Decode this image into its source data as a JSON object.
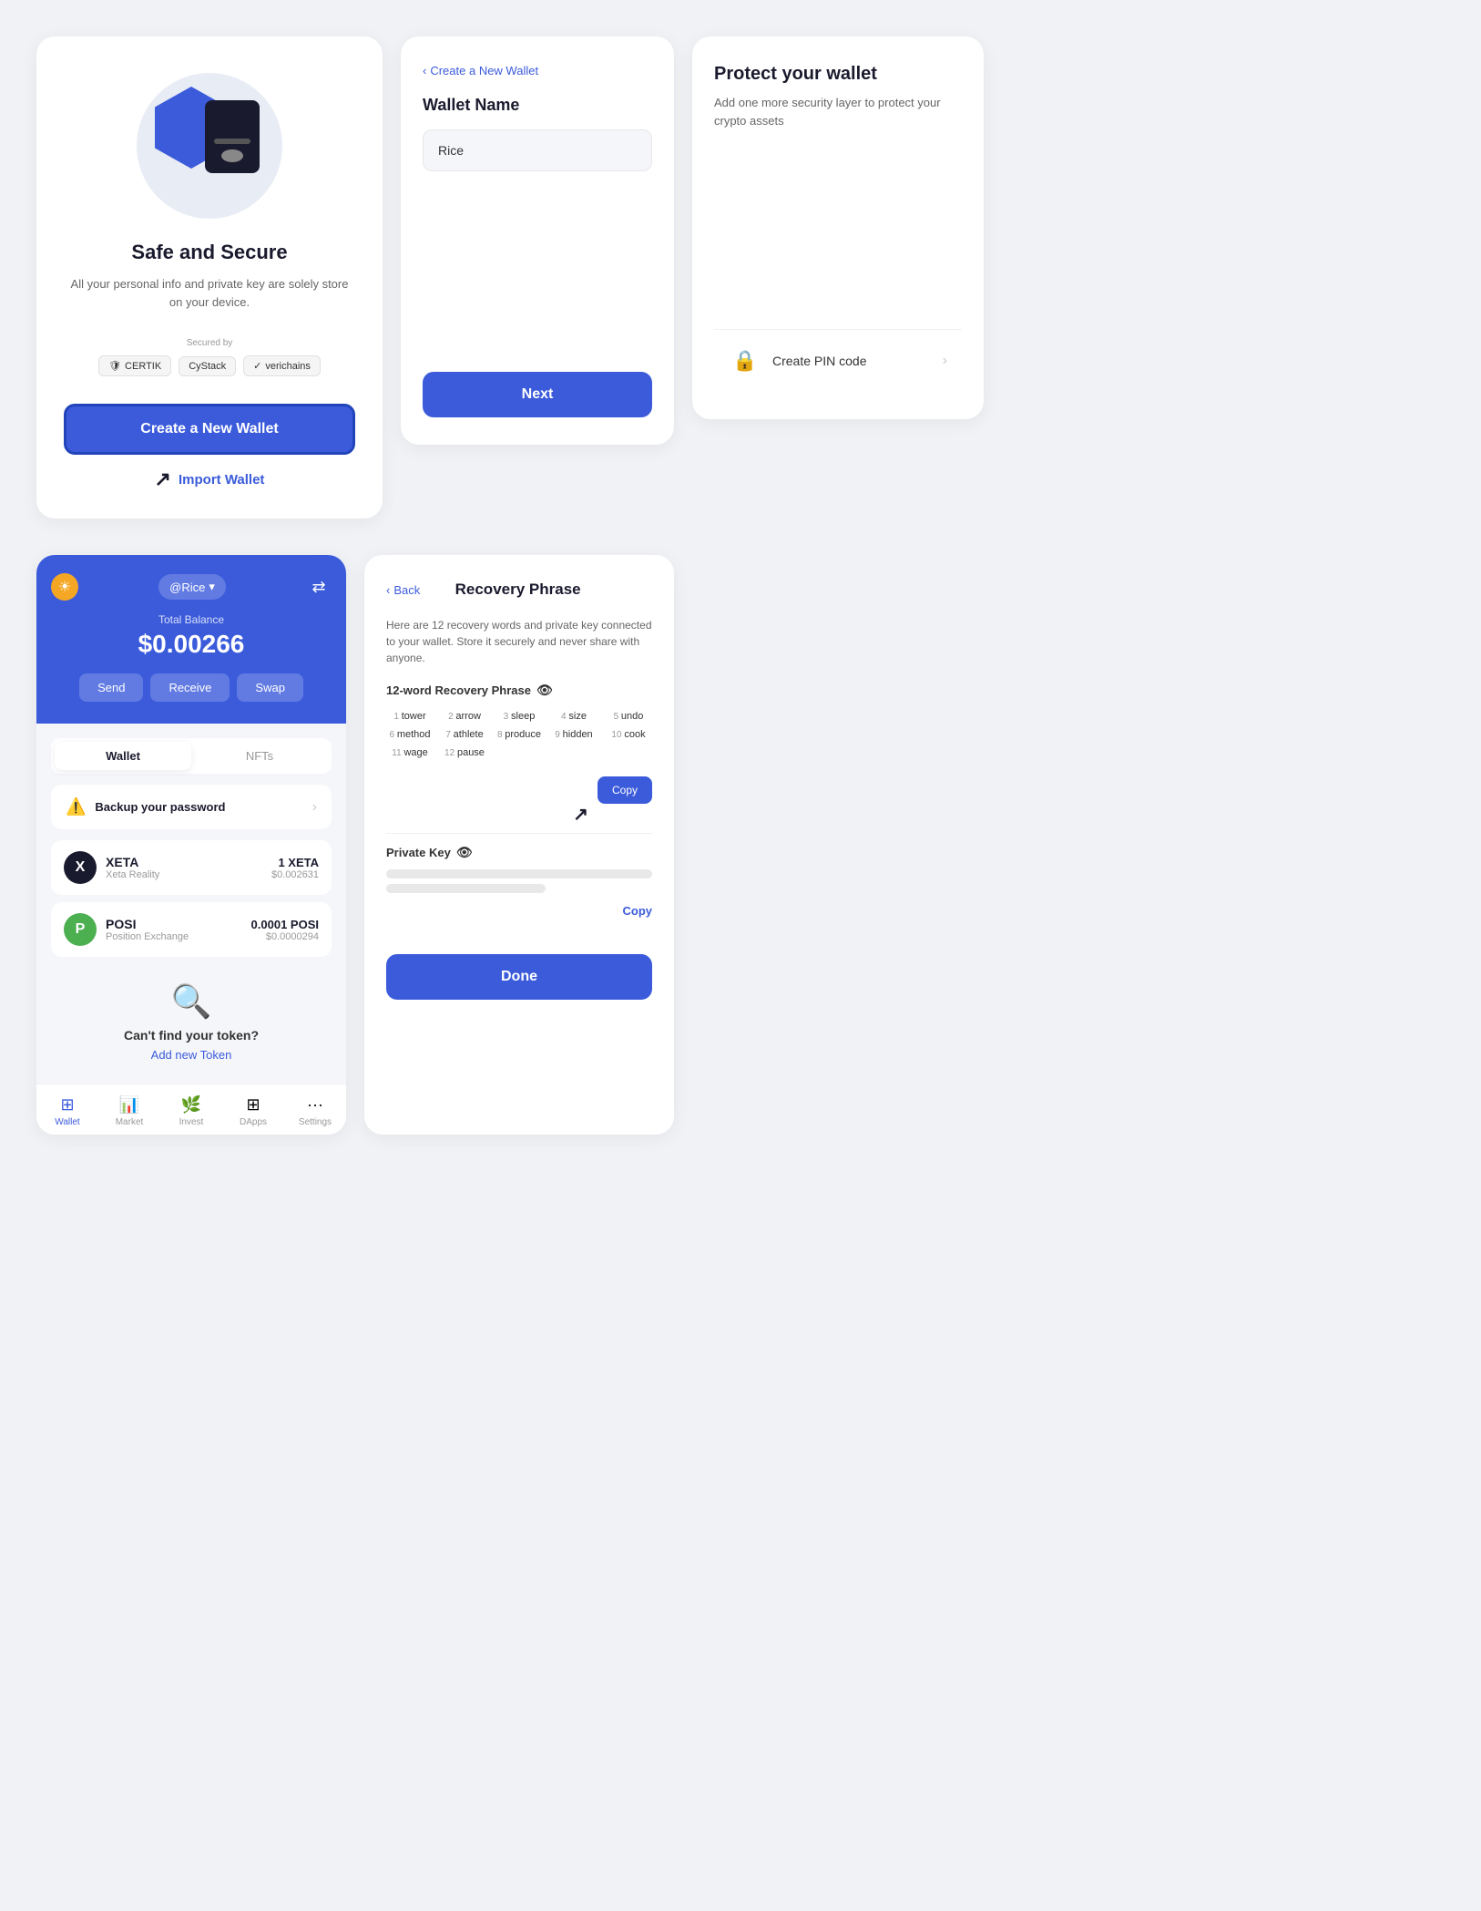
{
  "panels": {
    "safe": {
      "title": "Safe and Secure",
      "description": "All your personal info and private key are solely store on your device.",
      "secured_by": "Secured by",
      "badges": [
        "certik",
        "CyStack",
        "verichains"
      ],
      "create_button": "Create a New Wallet",
      "import_button": "Import Wallet"
    },
    "wallet_name": {
      "back_label": "Create a New Wallet",
      "label": "Wallet Name",
      "input_value": "Rice",
      "next_button": "Next"
    },
    "protect": {
      "title": "Protect your wallet",
      "description": "Add one more security layer to protect your crypto assets",
      "pin_label": "Create PIN code"
    },
    "mobile": {
      "logo_icon": "☀",
      "account": "@Rice",
      "balance_label": "Total Balance",
      "balance": "$0.00266",
      "actions": [
        "Send",
        "Receive",
        "Swap"
      ],
      "tabs": [
        "Wallet",
        "NFTs"
      ],
      "backup_text": "Backup your password",
      "tokens": [
        {
          "symbol": "XETA",
          "name": "Xeta Reality",
          "amount": "1 XETA",
          "usd": "$0.002631",
          "color": "xeta"
        },
        {
          "symbol": "POSI",
          "name": "Position Exchange",
          "amount": "0.0001 POSI",
          "usd": "$0.0000294",
          "color": "posi"
        }
      ],
      "cant_find": "Can't find your token?",
      "add_token": "Add new Token",
      "nav": [
        {
          "label": "Wallet",
          "icon": "⊞",
          "active": true
        },
        {
          "label": "Market",
          "icon": "📊",
          "active": false
        },
        {
          "label": "Invest",
          "icon": "🌿",
          "active": false
        },
        {
          "label": "DApps",
          "icon": "⊞",
          "active": false
        },
        {
          "label": "Settings",
          "icon": "···",
          "active": false
        }
      ]
    },
    "recovery": {
      "back_label": "Back",
      "title": "Recovery Phrase",
      "description": "Here are 12 recovery words and private key connected to your wallet. Store it securely and never share with anyone.",
      "phrase_label": "12-word Recovery Phrase",
      "words": [
        {
          "num": 1,
          "word": "tower"
        },
        {
          "num": 2,
          "word": "arrow"
        },
        {
          "num": 3,
          "word": "sleep"
        },
        {
          "num": 4,
          "word": "size"
        },
        {
          "num": 5,
          "word": "undo"
        },
        {
          "num": 6,
          "word": "method"
        },
        {
          "num": 7,
          "word": "athlete"
        },
        {
          "num": 8,
          "word": "produce"
        },
        {
          "num": 9,
          "word": "hidden"
        },
        {
          "num": 10,
          "word": "cook"
        },
        {
          "num": 11,
          "word": "wage"
        },
        {
          "num": 12,
          "word": "pause"
        }
      ],
      "copy_button": "Copy",
      "private_key_label": "Private Key",
      "private_key_copy": "Copy",
      "done_button": "Done"
    }
  }
}
